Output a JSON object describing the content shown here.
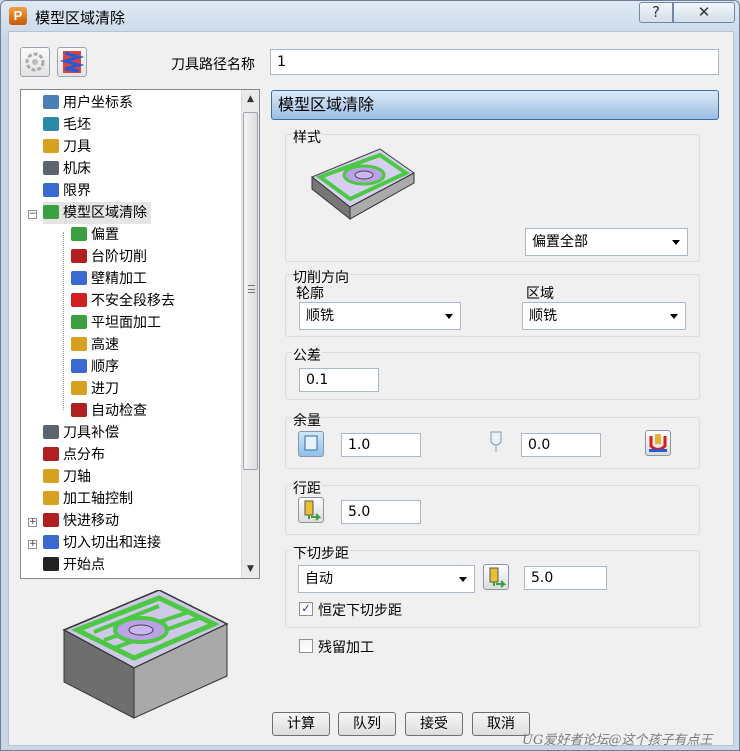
{
  "window": {
    "title": "模型区域清除",
    "help_label": "?",
    "close_label": "✕"
  },
  "header": {
    "toolpath_name_label": "刀具路径名称",
    "toolpath_name_value": "1"
  },
  "tree": {
    "items": [
      {
        "label": "用户坐标系",
        "icon": "user-coordinate-icon",
        "color": "#4a7fb5"
      },
      {
        "label": "毛坯",
        "icon": "block-icon",
        "color": "#2a8aa8"
      },
      {
        "label": "刀具",
        "icon": "tool-icon",
        "color": "#d6a020"
      },
      {
        "label": "机床",
        "icon": "machine-icon",
        "color": "#5b6470"
      },
      {
        "label": "限界",
        "icon": "limits-icon",
        "color": "#3a6ad0"
      },
      {
        "label": "模型区域清除",
        "icon": "area-clear-icon",
        "color": "#3aa040"
      },
      {
        "label": "偏置",
        "icon": "offset-icon",
        "color": "#3aa040"
      },
      {
        "label": "台阶切削",
        "icon": "step-cut-icon",
        "color": "#b02020"
      },
      {
        "label": "壁精加工",
        "icon": "wall-finish-icon",
        "color": "#3a6ad0"
      },
      {
        "label": "不安全段移去",
        "icon": "unsafe-removal-icon",
        "color": "#d02020"
      },
      {
        "label": "平坦面加工",
        "icon": "flat-machining-icon",
        "color": "#3aa040"
      },
      {
        "label": "高速",
        "icon": "high-speed-icon",
        "color": "#d6a020"
      },
      {
        "label": "顺序",
        "icon": "order-icon",
        "color": "#3a6ad0"
      },
      {
        "label": "进刀",
        "icon": "plunge-icon",
        "color": "#d6a020"
      },
      {
        "label": "自动检查",
        "icon": "auto-check-icon",
        "color": "#b02020"
      },
      {
        "label": "刀具补偿",
        "icon": "tool-compensation-icon",
        "color": "#5b6470"
      },
      {
        "label": "点分布",
        "icon": "point-distribution-icon",
        "color": "#b02020"
      },
      {
        "label": "刀轴",
        "icon": "tool-axis-icon",
        "color": "#d6a020"
      },
      {
        "label": "加工轴控制",
        "icon": "axis-control-icon",
        "color": "#d6a020"
      },
      {
        "label": "快进移动",
        "icon": "rapid-move-icon",
        "color": "#b02020"
      },
      {
        "label": "切入切出和连接",
        "icon": "leads-links-icon",
        "color": "#3a6ad0"
      },
      {
        "label": "开始点",
        "icon": "start-point-icon",
        "color": "#222222"
      }
    ]
  },
  "panel": {
    "title": "模型区域清除",
    "style": {
      "label": "样式",
      "value": "偏置全部"
    },
    "cut_direction": {
      "label": "切削方向",
      "profile_label": "轮廓",
      "profile_value": "顺铣",
      "area_label": "区域",
      "area_value": "顺铣"
    },
    "tolerance": {
      "label": "公差",
      "value": "0.1"
    },
    "allowance": {
      "label": "余量",
      "radial_value": "1.0",
      "axial_value": "0.0"
    },
    "stepover": {
      "label": "行距",
      "value": "5.0"
    },
    "stepdown": {
      "label": "下切步距",
      "mode": "自动",
      "value": "5.0",
      "constant_label": "恒定下切步距",
      "constant_checked": "✓"
    },
    "rest": {
      "label": "残留加工"
    }
  },
  "buttons": {
    "calculate": "计算",
    "queue": "队列",
    "accept": "接受",
    "cancel": "取消"
  },
  "watermark": "UG爱好者论坛@这个孩子有点王",
  "colors": {
    "accent": "#3c6ea5",
    "toolpath_green": "#4cc845",
    "purple": "#b9a2e6"
  }
}
